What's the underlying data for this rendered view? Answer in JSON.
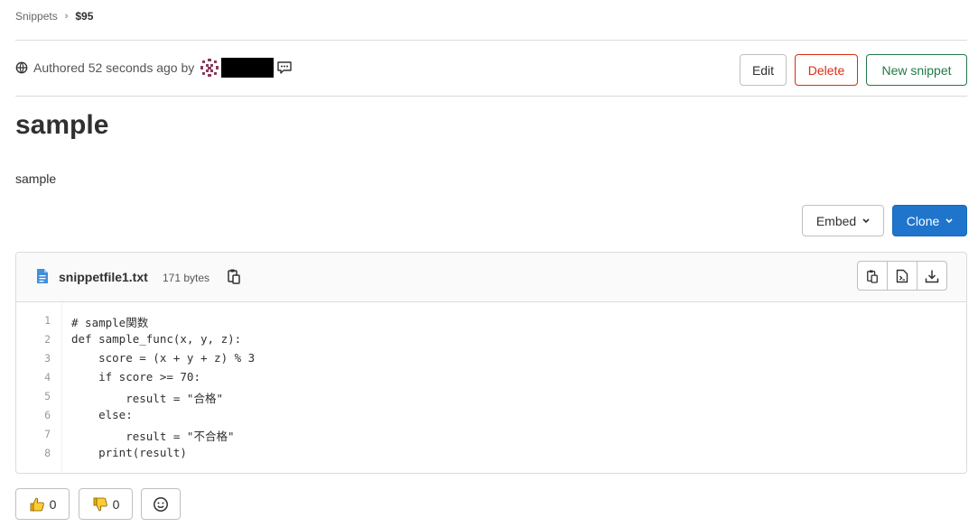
{
  "breadcrumb": {
    "parent": "Snippets",
    "separator": "›",
    "current": "$95"
  },
  "meta": {
    "authored_text": "Authored 52 seconds ago by"
  },
  "actions": {
    "edit": "Edit",
    "delete": "Delete",
    "new_snippet": "New snippet"
  },
  "snippet": {
    "title": "sample",
    "description": "sample"
  },
  "toolbar": {
    "embed": "Embed",
    "clone": "Clone"
  },
  "file": {
    "name": "snippetfile1.txt",
    "size": "171 bytes",
    "lines": [
      {
        "n": "1",
        "text": "# sample関数"
      },
      {
        "n": "2",
        "text": "def sample_func(x, y, z):"
      },
      {
        "n": "3",
        "text": "    score = (x + y + z) % 3"
      },
      {
        "n": "4",
        "text": "    if score >= 70:"
      },
      {
        "n": "5",
        "text": "        result = \"合格\""
      },
      {
        "n": "6",
        "text": "    else:"
      },
      {
        "n": "7",
        "text": "        result = \"不合格\""
      },
      {
        "n": "8",
        "text": "    print(result)"
      }
    ]
  },
  "reactions": {
    "thumbs_up_count": "0",
    "thumbs_down_count": "0"
  },
  "colors": {
    "danger": "#dd2b0e",
    "success": "#1f7a46",
    "primary": "#1f75cb",
    "border": "#dbdbdb"
  },
  "icons": [
    "chevron-right-icon",
    "globe-icon",
    "avatar",
    "comment-icon",
    "chevron-down-icon",
    "file-icon",
    "copy-icon",
    "open-raw-icon",
    "download-icon",
    "thumbs-up-icon",
    "thumbs-down-icon",
    "smiley-icon"
  ]
}
